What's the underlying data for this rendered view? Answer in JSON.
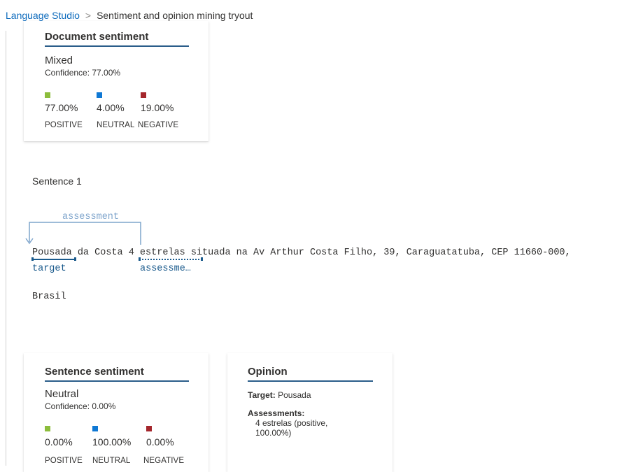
{
  "breadcrumb": {
    "link": "Language Studio",
    "separator": ">",
    "current": "Sentiment and opinion mining tryout"
  },
  "document_sentiment": {
    "title": "Document sentiment",
    "label": "Mixed",
    "confidence": "Confidence: 77.00%",
    "scores": [
      {
        "pct": "77.00%",
        "caption": "POSITIVE",
        "color": "#8cbd3c"
      },
      {
        "pct": "4.00%",
        "caption": "NEUTRAL",
        "color": "#0f78d4"
      },
      {
        "pct": "19.00%",
        "caption": "NEGATIVE",
        "color": "#a4262c"
      }
    ]
  },
  "sentence": {
    "label": "Sentence 1",
    "line1": {
      "target_word": "Pousada",
      "middle": " da Costa ",
      "assessment_word": "4 estrelas",
      "rest": " situada na Av Arthur Costa Filho, 39, Caraguatatuba, CEP 11660-000,"
    },
    "line2": "Brasil",
    "arc_label": "assessment",
    "target_tag": "target",
    "assessment_tag": "assessme…",
    "colors": {
      "target": "#1a5a8c",
      "arc": "#7fa5cc"
    }
  },
  "sentence_sentiment": {
    "title": "Sentence sentiment",
    "label": "Neutral",
    "confidence": "Confidence: 0.00%",
    "scores": [
      {
        "pct": "0.00%",
        "caption": "POSITIVE",
        "color": "#8cbd3c"
      },
      {
        "pct": "100.00%",
        "caption": "NEUTRAL",
        "color": "#0f78d4"
      },
      {
        "pct": "0.00%",
        "caption": "NEGATIVE",
        "color": "#a4262c"
      }
    ]
  },
  "opinion": {
    "title": "Opinion",
    "target_label": "Target:",
    "target_value": "Pousada",
    "assessments_label": "Assessments:",
    "assessment_line1": "4 estrelas (positive,",
    "assessment_line2": "100.00%)"
  }
}
